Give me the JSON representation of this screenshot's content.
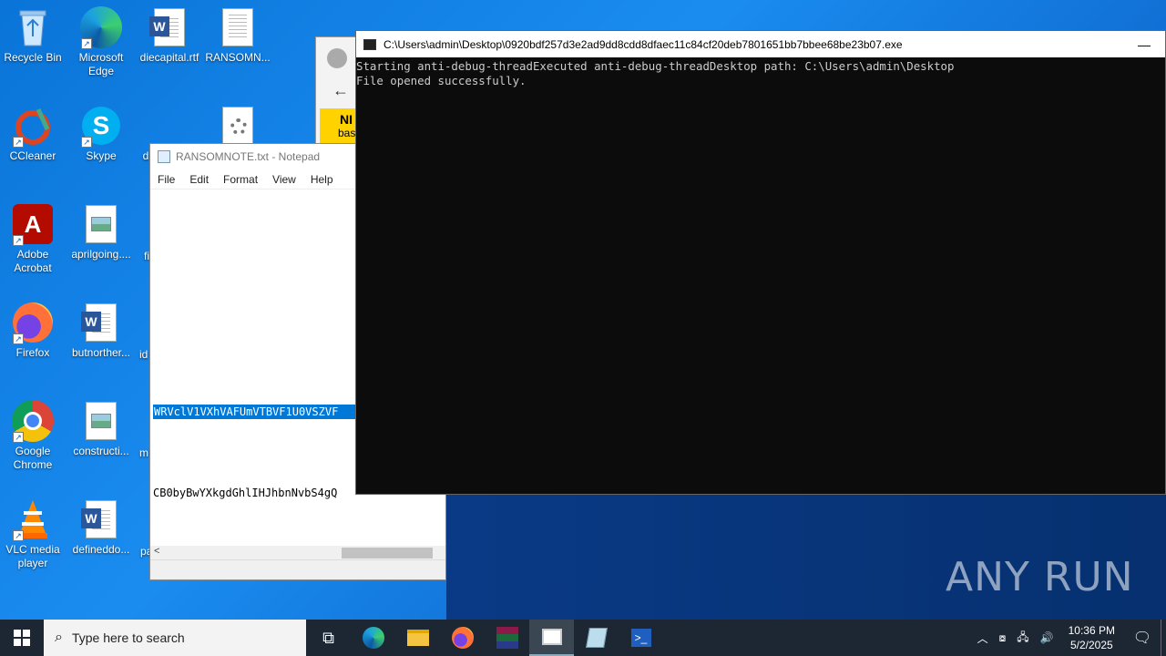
{
  "desktop": {
    "icons": [
      {
        "label": "Recycle Bin"
      },
      {
        "label": "Microsoft Edge"
      },
      {
        "label": "diecapital.rtf"
      },
      {
        "label": "RANSOMN..."
      },
      {
        "label": "CCleaner"
      },
      {
        "label": "Skype"
      },
      {
        "label": "d"
      },
      {
        "label": "Adobe Acrobat"
      },
      {
        "label": "aprilgoing...."
      },
      {
        "label": "fi"
      },
      {
        "label": "Firefox"
      },
      {
        "label": "butnorther..."
      },
      {
        "label": "id"
      },
      {
        "label": "Google Chrome"
      },
      {
        "label": "constructi..."
      },
      {
        "label": "m"
      },
      {
        "label": "VLC media player"
      },
      {
        "label": "defineddo..."
      },
      {
        "label": "pa"
      }
    ]
  },
  "notepad": {
    "title": "RANSOMNOTE.txt - Notepad",
    "menu": [
      "File",
      "Edit",
      "Format",
      "View",
      "Help"
    ],
    "line_selected": "WRVclV1VXhVAFUmVTBVF1U0VSZVF",
    "line_cut": "CB0byBwYXkgdGhlIHJhbnNvbS4gQ"
  },
  "edge_window": {
    "banner_text": "NI",
    "sub_text": "bas"
  },
  "console": {
    "title": "C:\\Users\\admin\\Desktop\\0920bdf257d3e2ad9dd8cdd8dfaec11c84cf20deb7801651bb7bbee68be23b07.exe",
    "minimize": "—",
    "output": "Starting anti-debug-threadExecuted anti-debug-threadDesktop path: C:\\Users\\admin\\Desktop\nFile opened successfully."
  },
  "watermark": "ANY RUN",
  "taskbar": {
    "search_placeholder": "Type here to search",
    "time": "10:36 PM",
    "date": "5/2/2025"
  }
}
